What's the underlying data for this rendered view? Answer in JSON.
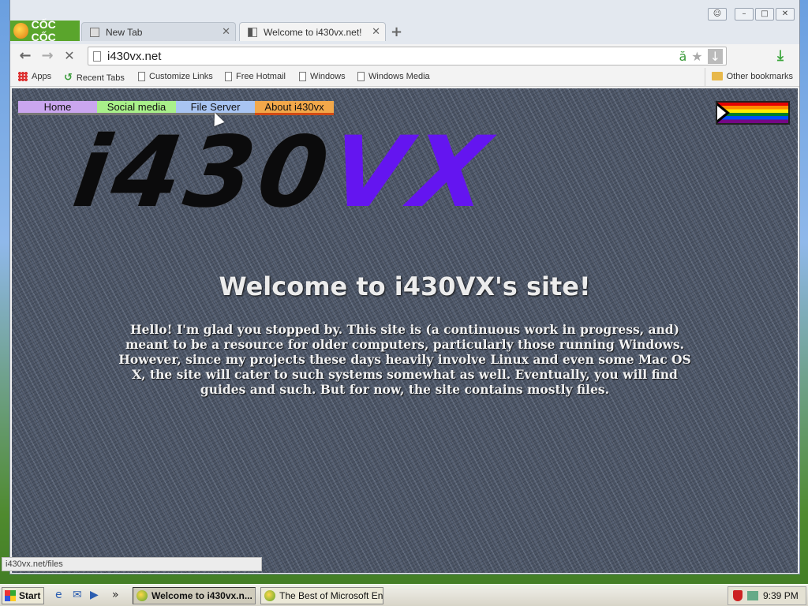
{
  "browser": {
    "brand": "CỐC CỐC",
    "tabs": [
      {
        "label": "New Tab",
        "active": false
      },
      {
        "label": "Welcome to i430vx.net!",
        "active": true
      }
    ],
    "url": "i430vx.net",
    "bookmarks": [
      {
        "label": "Apps",
        "icon": "apps-icon"
      },
      {
        "label": "Recent Tabs",
        "icon": "recent-tabs-icon"
      },
      {
        "label": "Customize Links",
        "icon": "page-icon"
      },
      {
        "label": "Free Hotmail",
        "icon": "page-icon"
      },
      {
        "label": "Windows",
        "icon": "page-icon"
      },
      {
        "label": "Windows Media",
        "icon": "page-icon"
      }
    ],
    "other_bookmarks": "Other bookmarks",
    "status_url": "i430vx.net/files"
  },
  "site": {
    "nav": [
      "Home",
      "Social media",
      "File Server",
      "About i430vx"
    ],
    "logo_dark": "i430",
    "logo_purple": "VX",
    "heading": "Welcome to i430VX's site!",
    "intro": "Hello! I'm glad you stopped by. This site is (a continuous work in progress, and) meant to be a resource for older computers, particularly those running Windows. However, since my projects these days heavily involve Linux and even some Mac OS X, the site will cater to such systems somewhat as well. Eventually, you will find guides and such. But for now, the site contains mostly files."
  },
  "taskbar": {
    "start": "Start",
    "tasks": [
      {
        "label": "Welcome to i430vx.n...",
        "active": true
      },
      {
        "label": "The Best of Microsoft En...",
        "active": false
      }
    ],
    "clock": "9:39 PM"
  },
  "colors": {
    "accent_green": "#5aa52c",
    "logo_purple": "#6415f0",
    "nav_home": "#caa6ef",
    "nav_social": "#a9f08a",
    "nav_files": "#a8c4f2",
    "nav_about": "#f2a84a"
  }
}
